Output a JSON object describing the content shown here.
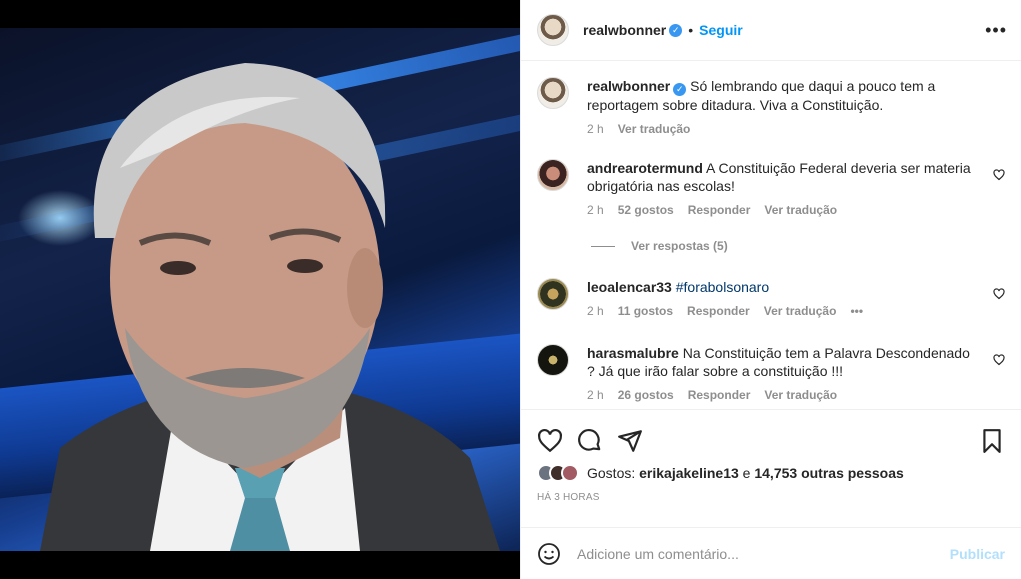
{
  "post": {
    "author": "realwbonner",
    "follow_label": "Seguir",
    "more_icon": "more-icon",
    "caption": "Só lembrando que daqui a pouco tem a reportagem sobre ditadura. Viva a Constituição.",
    "caption_time": "2 h",
    "caption_translate": "Ver tradução"
  },
  "comments": [
    {
      "user": "andrearotermund",
      "text": "A Constituição Federal deveria ser materia obrigatória nas escolas!",
      "time": "2 h",
      "likes": "52 gostos",
      "reply": "Responder",
      "translate": "Ver tradução",
      "view_replies": "Ver respostas (5)"
    },
    {
      "user": "leoalencar33",
      "text": "#forabolsonaro",
      "time": "2 h",
      "likes": "11 gostos",
      "reply": "Responder",
      "translate": "Ver tradução",
      "more": "•••"
    },
    {
      "user": "harasmalubre",
      "text": "Na Constituição tem a Palavra Descondenado ? Já que irão falar sobre a constituição !!!",
      "time": "2 h",
      "likes": "26 gostos",
      "reply": "Responder",
      "translate": "Ver tradução"
    }
  ],
  "likes": {
    "prefix": "Gostos:",
    "first_liker": "erikajakeline13",
    "connector": "e",
    "others": "14,753 outras pessoas"
  },
  "posted_ago": "HÁ 3 HORAS",
  "composer": {
    "placeholder": "Adicione um comentário...",
    "publish_label": "Publicar"
  },
  "colors": {
    "link_blue": "#0095f6",
    "publish_disabled": "#b2dffc",
    "muted": "#8e8e8e",
    "text": "#262626",
    "verified": "#3897f0"
  }
}
